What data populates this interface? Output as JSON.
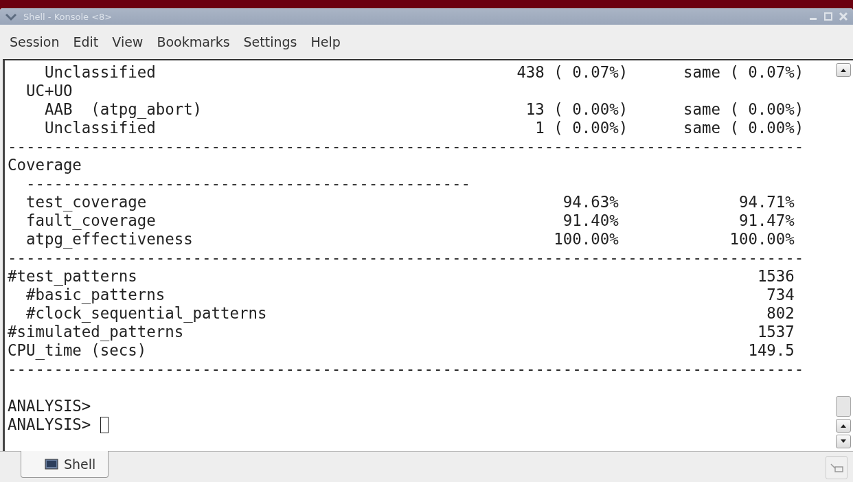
{
  "window": {
    "title": "Shell - Konsole <8>"
  },
  "menu": [
    "Session",
    "Edit",
    "View",
    "Bookmarks",
    "Settings",
    "Help"
  ],
  "terminal": {
    "lines": [
      {
        "kind": "fault",
        "label": "    Unclassified",
        "count": "438",
        "pct": "( 0.07%)",
        "cmp": "same",
        "cmp_pct": "( 0.07%)"
      },
      {
        "kind": "text",
        "text": "  UC+UO"
      },
      {
        "kind": "fault",
        "label": "    AAB  (atpg_abort)",
        "count": "13",
        "pct": "( 0.00%)",
        "cmp": "same",
        "cmp_pct": "( 0.00%)"
      },
      {
        "kind": "fault",
        "label": "    Unclassified",
        "count": "1",
        "pct": "( 0.00%)",
        "cmp": "same",
        "cmp_pct": "( 0.00%)"
      },
      {
        "kind": "rule",
        "text": "--------------------------------------------------------------------------------------"
      },
      {
        "kind": "text",
        "text": "Coverage"
      },
      {
        "kind": "rule",
        "text": "  ------------------------------------------------"
      },
      {
        "kind": "coverage",
        "label": "  test_coverage",
        "v1": "94.63%",
        "v2": "94.71%"
      },
      {
        "kind": "coverage",
        "label": "  fault_coverage",
        "v1": "91.40%",
        "v2": "91.47%"
      },
      {
        "kind": "coverage",
        "label": "  atpg_effectiveness",
        "v1": "100.00%",
        "v2": "100.00%"
      },
      {
        "kind": "rule",
        "text": "--------------------------------------------------------------------------------------"
      },
      {
        "kind": "count",
        "label": "#test_patterns",
        "value": "1536"
      },
      {
        "kind": "count",
        "label": "  #basic_patterns",
        "value": "734"
      },
      {
        "kind": "count",
        "label": "  #clock_sequential_patterns",
        "value": "802"
      },
      {
        "kind": "count",
        "label": "#simulated_patterns",
        "value": "1537"
      },
      {
        "kind": "count",
        "label": "CPU_time (secs)",
        "value": "149.5"
      },
      {
        "kind": "rule",
        "text": "--------------------------------------------------------------------------------------"
      },
      {
        "kind": "blank"
      },
      {
        "kind": "prompt",
        "text": "ANALYSIS>"
      },
      {
        "kind": "prompt",
        "text": "ANALYSIS>",
        "cursor": true
      }
    ]
  },
  "tabs": [
    {
      "label": "Shell",
      "selected": true
    }
  ]
}
